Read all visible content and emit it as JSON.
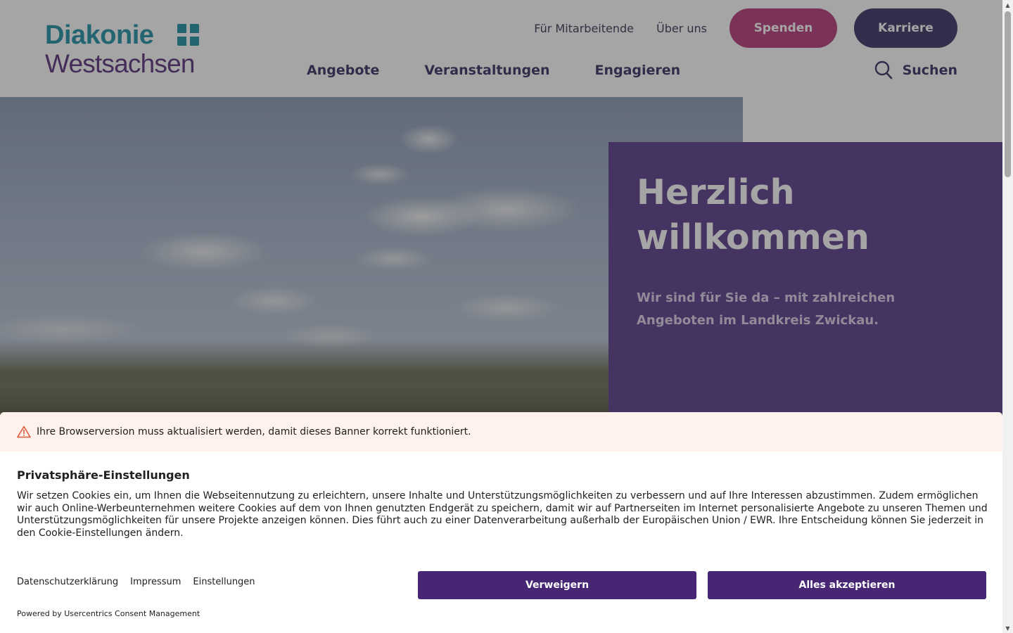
{
  "header": {
    "logo": {
      "line1": "Diakonie",
      "line2": "Westsachsen"
    },
    "top_links": [
      "Für Mitarbeitende",
      "Über uns"
    ],
    "donate_label": "Spenden",
    "career_label": "Karriere",
    "nav": [
      "Angebote",
      "Veranstaltungen",
      "Engagieren"
    ],
    "search_label": "Suchen"
  },
  "hero": {
    "title": "Herzlich willkommen",
    "subtitle": "Wir sind für Sie da – mit zahlreichen Angeboten im Landkreis Zwickau."
  },
  "consent": {
    "warning": "Ihre Browserversion muss aktualisiert werden, damit dieses Banner korrekt funktioniert.",
    "title": "Privatsphäre-Einstellungen",
    "body": "Wir setzen Cookies ein, um Ihnen die Webseitennutzung zu erleichtern, unsere Inhalte und Unterstützungsmöglichkeiten zu verbessern und auf Ihre Interessen abzustimmen. Zudem ermöglichen wir auch Online-Werbeunternehmen weitere Cookies auf dem von Ihnen genutzten Endgerät zu speichern, damit wir auf Partnerseiten im Internet personalisierte Angebote zu unseren Themen und Unterstützungsmöglichkeiten für unsere Projekte anzeigen können. Dies führt auch zu einer Datenverarbeitung außerhalb der Europäischen Union / EWR. Ihre Entscheidung können Sie jederzeit in den Cookie-Einstellungen ändern.",
    "links": [
      "Datenschutzerklärung",
      "Impressum",
      "Einstellungen"
    ],
    "deny_label": "Verweigern",
    "accept_label": "Alles akzeptieren",
    "powered_by": "Powered by Usercentrics Consent Management"
  },
  "colors": {
    "brand_teal": "#1f8fa6",
    "brand_purple": "#59317a",
    "donate": "#b6397a",
    "career": "#3d3266",
    "consent_button": "#472674",
    "warning_bg": "#fff1ec"
  }
}
